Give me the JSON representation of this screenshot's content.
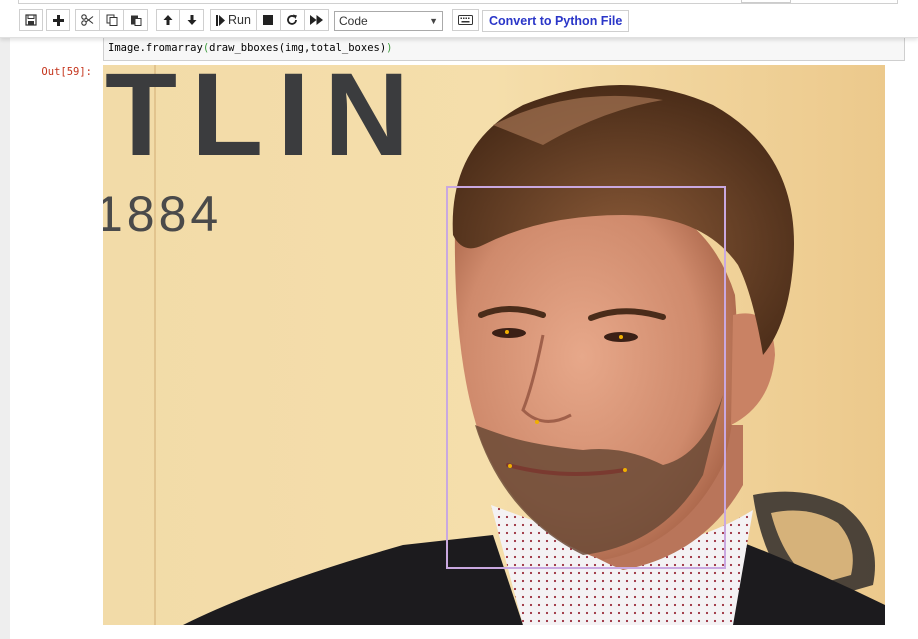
{
  "toolbar": {
    "buttons": {
      "save_icon": "save-icon",
      "add_icon": "plus-icon",
      "cut_icon": "scissors-icon",
      "copy_icon": "copy-icon",
      "paste_icon": "paste-icon",
      "up_icon": "arrow-up-icon",
      "down_icon": "arrow-down-icon",
      "run_label": "Run",
      "stop_icon": "stop-icon",
      "restart_icon": "restart-icon",
      "fast_forward_icon": "fast-forward-icon",
      "keyboard_icon": "keyboard-icon"
    },
    "cell_type": "Code",
    "convert_label": "Convert to Python File"
  },
  "cell": {
    "code": {
      "prefix": "Image.fromarray",
      "open_paren": "(",
      "args": "draw_bboxes(img,total_boxes)",
      "close_paren": ")"
    },
    "output_prompt": "Out[59]:"
  },
  "output_image": {
    "description_text": {
      "background_letters": "TLIN",
      "background_number": "1884"
    },
    "bbox_color": "#c9a8e0",
    "landmark_color": "#f0b000"
  }
}
